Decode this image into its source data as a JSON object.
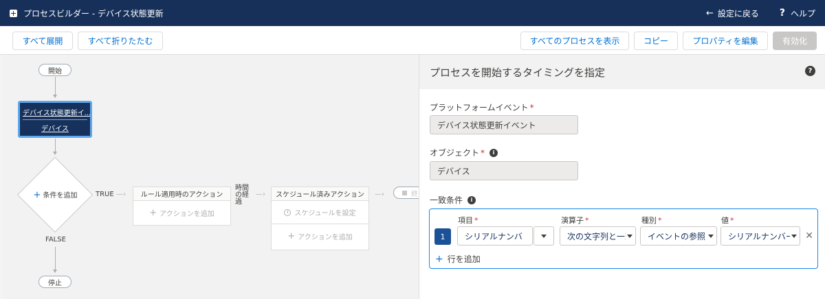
{
  "header": {
    "title": "プロセスビルダー - デバイス状態更新",
    "back_label": "設定に戻る",
    "help_label": "ヘルプ"
  },
  "toolbar": {
    "expand_all": "すべて展開",
    "collapse_all": "すべて折りたたむ",
    "view_all": "すべてのプロセスを表示",
    "copy": "コピー",
    "edit_properties": "プロパティを編集",
    "activate": "有効化"
  },
  "canvas": {
    "start": "開始",
    "criteria_title": "デバイス状態更新イ...",
    "criteria_object": "デバイス",
    "add_criteria": "条件を追加",
    "true_label": "TRUE",
    "false_label": "FALSE",
    "immediate_header": "ルール適用時のアクション",
    "add_action": "アクションを追加",
    "time_elapsed": "時間の経過",
    "scheduled_header": "スケジュール済みアクション",
    "set_schedule": "スケジュールを設定",
    "stop": "停止",
    "end_partial": "終"
  },
  "panel": {
    "title": "プロセスを開始するタイミングを指定",
    "platform_event_label": "プラットフォームイベント",
    "platform_event_value": "デバイス状態更新イベント",
    "object_label": "オブジェクト",
    "object_value": "デバイス",
    "match_label": "一致条件",
    "columns": {
      "field": "項目",
      "operator": "演算子",
      "type": "種別",
      "value": "値"
    },
    "row": {
      "num": "1",
      "field": "シリアルナンバー",
      "operator": "次の文字列と一致する",
      "type": "イベントの参照",
      "value": "シリアルナンバー"
    },
    "add_row": "行を追加"
  },
  "colors": {
    "header_bg": "#17305a",
    "accent": "#0070d2",
    "selected_border": "#5fa8ee"
  }
}
